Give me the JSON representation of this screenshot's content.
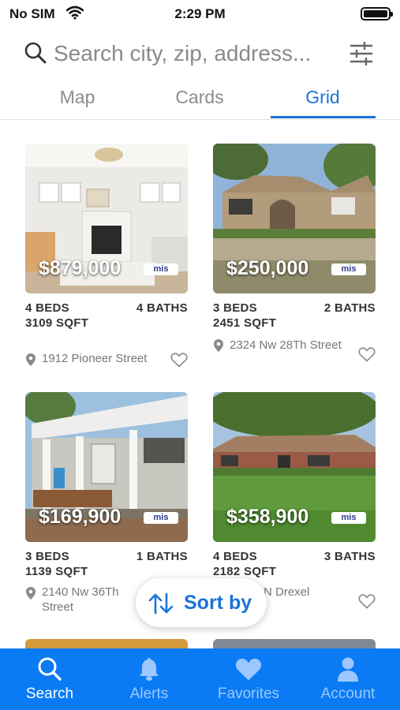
{
  "status": {
    "carrier": "No SIM",
    "time": "2:29 PM"
  },
  "search": {
    "placeholder": "Search city, zip, address..."
  },
  "view_tabs": [
    {
      "label": "Map",
      "active": false
    },
    {
      "label": "Cards",
      "active": false
    },
    {
      "label": "Grid",
      "active": true
    }
  ],
  "listings": [
    {
      "price": "$879,000",
      "badge": "mis",
      "beds": "4 BEDS",
      "baths": "4 BATHS",
      "sqft": "3109 SQFT",
      "address": "1912 Pioneer Street"
    },
    {
      "price": "$250,000",
      "badge": "mis",
      "beds": "3 BEDS",
      "baths": "2 BATHS",
      "sqft": "2451 SQFT",
      "address": "2324 Nw 28Th Street"
    },
    {
      "price": "$169,900",
      "badge": "mis",
      "beds": "3 BEDS",
      "baths": "1 BATHS",
      "sqft": "1139 SQFT",
      "address": "2140 Nw 36Th Street"
    },
    {
      "price": "$358,900",
      "badge": "mis",
      "beds": "4 BEDS",
      "baths": "3 BATHS",
      "sqft": "2182 SQFT",
      "address": "N Drexel"
    }
  ],
  "sort": {
    "label": "Sort by"
  },
  "bottom_tabs": [
    {
      "label": "Search",
      "icon": "search-icon",
      "active": true
    },
    {
      "label": "Alerts",
      "icon": "bell-icon",
      "active": false
    },
    {
      "label": "Favorites",
      "icon": "heart-icon",
      "active": false
    },
    {
      "label": "Account",
      "icon": "person-icon",
      "active": false
    }
  ],
  "colors": {
    "accent": "#1a73d9",
    "tabbar": "#0a7bf5",
    "tab_inactive": "#9cc7ff"
  }
}
